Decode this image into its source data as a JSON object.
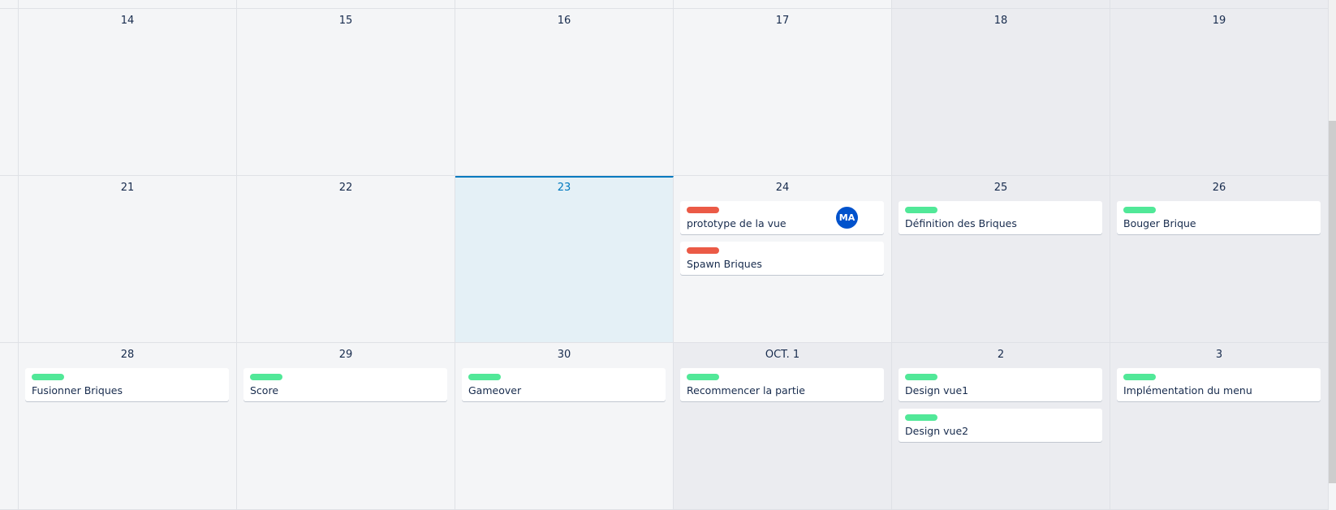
{
  "colors": {
    "accent": "#0079bf",
    "label_red": "#eb5a46",
    "label_green": "#51e898",
    "avatar": "#0052cc"
  },
  "weeks": [
    {
      "days": [
        {
          "label": "14",
          "shade": "normal",
          "cards": []
        },
        {
          "label": "15",
          "shade": "normal",
          "cards": []
        },
        {
          "label": "16",
          "shade": "normal",
          "cards": []
        },
        {
          "label": "17",
          "shade": "normal",
          "cards": []
        },
        {
          "label": "18",
          "shade": "gray",
          "cards": []
        },
        {
          "label": "19",
          "shade": "gray",
          "cards": []
        }
      ]
    },
    {
      "days": [
        {
          "label": "21",
          "shade": "normal",
          "cards": []
        },
        {
          "label": "22",
          "shade": "normal",
          "cards": []
        },
        {
          "label": "23",
          "shade": "today",
          "cards": []
        },
        {
          "label": "24",
          "shade": "normal",
          "cards": [
            {
              "title": "prototype de la vue",
              "label_color": "red",
              "member": "MA"
            },
            {
              "title": "Spawn Briques",
              "label_color": "red"
            }
          ]
        },
        {
          "label": "25",
          "shade": "gray",
          "cards": [
            {
              "title": "Définition des Briques",
              "label_color": "green"
            }
          ]
        },
        {
          "label": "26",
          "shade": "gray",
          "cards": [
            {
              "title": "Bouger Brique",
              "label_color": "green"
            }
          ]
        }
      ]
    },
    {
      "days": [
        {
          "label": "28",
          "shade": "normal",
          "cards": [
            {
              "title": "Fusionner Briques",
              "label_color": "green"
            }
          ]
        },
        {
          "label": "29",
          "shade": "normal",
          "cards": [
            {
              "title": "Score",
              "label_color": "green"
            }
          ]
        },
        {
          "label": "30",
          "shade": "normal",
          "cards": [
            {
              "title": "Gameover",
              "label_color": "green"
            }
          ]
        },
        {
          "label": "OCT. 1",
          "shade": "gray",
          "cards": [
            {
              "title": "Recommencer la partie",
              "label_color": "green"
            }
          ]
        },
        {
          "label": "2",
          "shade": "gray",
          "cards": [
            {
              "title": "Design vue1",
              "label_color": "green"
            },
            {
              "title": "Design vue2",
              "label_color": "green"
            }
          ]
        },
        {
          "label": "3",
          "shade": "gray",
          "cards": [
            {
              "title": "Implémentation du menu",
              "label_color": "green"
            }
          ]
        }
      ]
    }
  ]
}
